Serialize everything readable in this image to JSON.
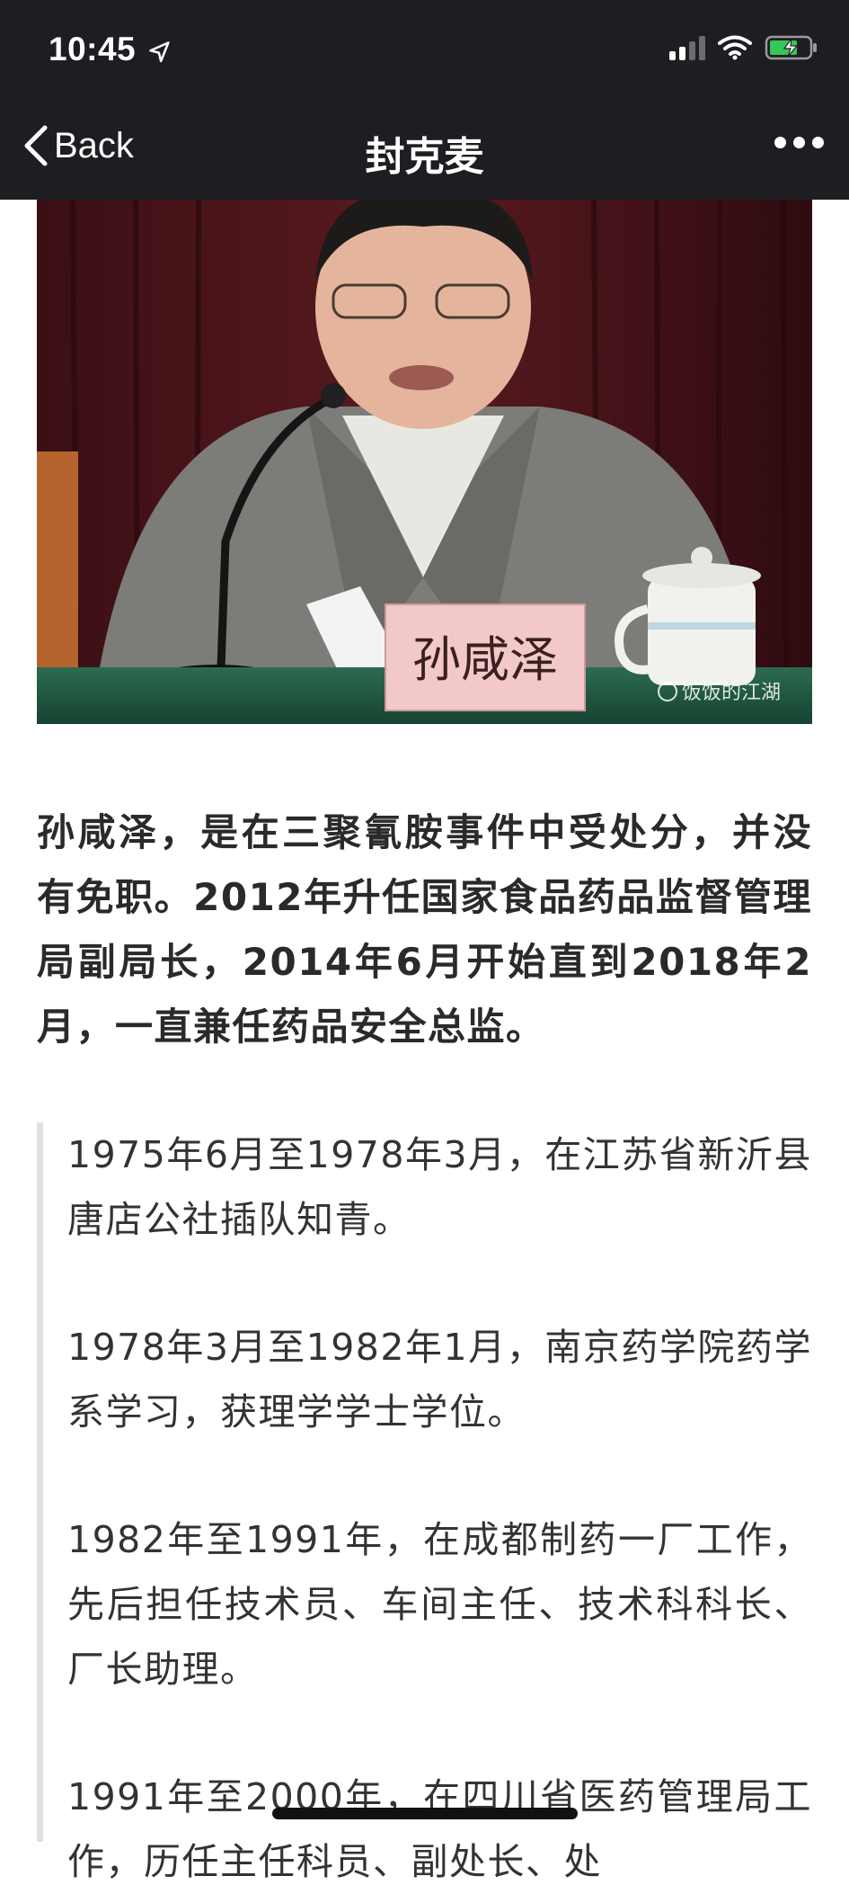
{
  "status_bar": {
    "time": "10:45",
    "location_icon": "location-arrow-icon",
    "signal_icon": "cellular-signal-icon",
    "wifi_icon": "wifi-icon",
    "battery_icon": "battery-charging-icon"
  },
  "nav": {
    "back_label": "Back",
    "title": "封克麦",
    "more_icon": "more-dots-icon"
  },
  "photo": {
    "nameplate": "孙咸泽",
    "watermark": "饭饭的江湖"
  },
  "article": {
    "lead": "孙咸泽，是在三聚氰胺事件中受处分，并没有免职。2012年升任国家食品药品监督管理局副局长，2014年6月开始直到2018年2月，一直兼任药品安全总监。",
    "quote": [
      "1975年6月至1978年3月，在江苏省新沂县唐店公社插队知青。",
      "1978年3月至1982年1月，南京药学院药学系学习，获理学学士学位。",
      "1982年至1991年，在成都制药一厂工作，先后担任技术员、车间主任、技术科科长、厂长助理。",
      "1991年至2000年，在四川省医药管理局工作，历任主任科员、副处长、处"
    ]
  },
  "colors": {
    "top_bar": "#1e1e22",
    "battery": "#34c759",
    "quote_border": "#e1e1e1"
  }
}
